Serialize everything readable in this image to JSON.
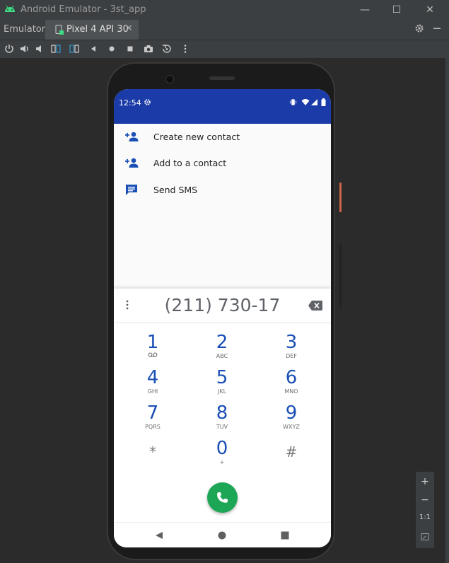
{
  "window": {
    "title": "Android Emulator - 3st_app",
    "minimize": "—",
    "maximize": "☐",
    "close": "✕"
  },
  "tabbar": {
    "label": "Emulator:",
    "device_tab": "Pixel 4 API 30",
    "close_glyph": "✕"
  },
  "toolbar": {
    "icons": [
      "power-icon",
      "volume-up-icon",
      "volume-down-icon",
      "rotate-left-icon",
      "rotate-right-icon",
      "back-icon",
      "home-icon",
      "overview-icon",
      "camera-icon",
      "snapshot-icon",
      "more-icon"
    ]
  },
  "zoom": {
    "plus": "+",
    "minus": "−",
    "one_to_one": "1:1"
  },
  "status": {
    "time": "12:54"
  },
  "actions": [
    {
      "label": "Create new contact",
      "icon": "person-add-icon"
    },
    {
      "label": "Add to a contact",
      "icon": "person-add-icon"
    },
    {
      "label": "Send SMS",
      "icon": "message-icon"
    }
  ],
  "dialer": {
    "number": "(211) 730-17",
    "keys": [
      {
        "digit": "1",
        "letters": ""
      },
      {
        "digit": "2",
        "letters": "ABC"
      },
      {
        "digit": "3",
        "letters": "DEF"
      },
      {
        "digit": "4",
        "letters": "GHI"
      },
      {
        "digit": "5",
        "letters": "JKL"
      },
      {
        "digit": "6",
        "letters": "MNO"
      },
      {
        "digit": "7",
        "letters": "PQRS"
      },
      {
        "digit": "8",
        "letters": "TUV"
      },
      {
        "digit": "9",
        "letters": "WXYZ"
      },
      {
        "digit": "*",
        "letters": ""
      },
      {
        "digit": "0",
        "letters": "+"
      },
      {
        "digit": "#",
        "letters": ""
      }
    ]
  },
  "colors": {
    "status_bar": "#1a3ba8",
    "accent": "#1a4fb5",
    "call": "#1ea657"
  }
}
